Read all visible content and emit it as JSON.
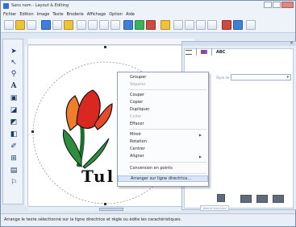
{
  "window": {
    "title": "Sans nom - Layout & Editing"
  },
  "menubar": {
    "items": [
      "Fichier",
      "Edition",
      "Image",
      "Texte",
      "Broderie",
      "Affichage",
      "Option",
      "Aide"
    ]
  },
  "canvas": {
    "artwork_text": "Tul"
  },
  "context_menu": {
    "items": [
      {
        "label": "Grouper",
        "disabled": false
      },
      {
        "label": "Séparer",
        "disabled": true
      },
      {
        "label": "Couper",
        "disabled": false
      },
      {
        "label": "Copier",
        "disabled": false
      },
      {
        "label": "Dupliquer",
        "disabled": false
      },
      {
        "label": "Coller",
        "disabled": true
      },
      {
        "label": "Effacer",
        "disabled": false
      },
      {
        "label": "Miroir",
        "disabled": false,
        "submenu": true
      },
      {
        "label": "Rotation",
        "disabled": false
      },
      {
        "label": "Centrer",
        "disabled": false
      },
      {
        "label": "Aligner",
        "disabled": false,
        "submenu": true
      },
      {
        "label": "Conversion en points",
        "disabled": false
      },
      {
        "label": "Arranger sur ligne directrice...",
        "disabled": false,
        "highlighted": true
      }
    ]
  },
  "panel": {
    "tab_text": "ABC",
    "style_label": "Style de fil",
    "small_button": "Vers le haut liste"
  },
  "statusbar": {
    "text": "Arrange le texte sélectionné sur la ligne directrice et règle ou édite les caractéristiques."
  }
}
